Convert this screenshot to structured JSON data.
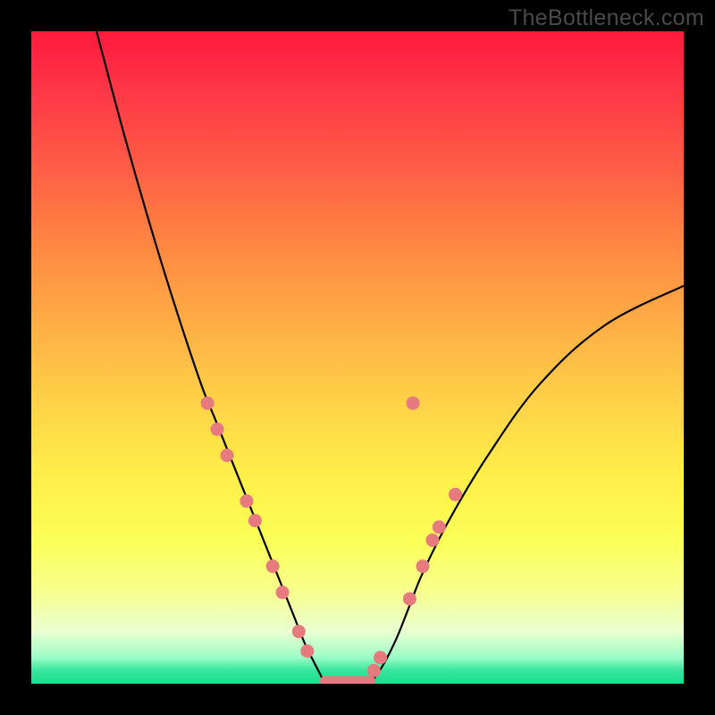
{
  "watermark": "TheBottleneck.com",
  "colors": {
    "dot": "#e77a7f",
    "curve": "#000000",
    "background_black": "#000000"
  },
  "chart_data": {
    "type": "line",
    "title": "",
    "xlabel": "",
    "ylabel": "",
    "xlim": [
      0,
      100
    ],
    "ylim": [
      0,
      100
    ],
    "series": [
      {
        "name": "left-curve",
        "x": [
          10,
          14,
          18,
          22,
          26,
          28,
          30,
          32,
          34,
          36,
          38,
          40,
          42,
          44,
          45
        ],
        "y": [
          100,
          85,
          71,
          58,
          46,
          41,
          36,
          31,
          26,
          21,
          16,
          11,
          6,
          2,
          0
        ]
      },
      {
        "name": "right-curve",
        "x": [
          52,
          54,
          56,
          58,
          60,
          64,
          70,
          78,
          88,
          100
        ],
        "y": [
          0,
          3,
          7,
          12,
          17,
          25,
          35,
          46,
          55,
          61
        ]
      },
      {
        "name": "bottom-flat",
        "x": [
          45,
          52
        ],
        "y": [
          0,
          0
        ]
      }
    ],
    "dots_left": [
      {
        "x": 27,
        "y": 43
      },
      {
        "x": 28.5,
        "y": 39
      },
      {
        "x": 30,
        "y": 35
      },
      {
        "x": 33,
        "y": 28
      },
      {
        "x": 34.3,
        "y": 25
      },
      {
        "x": 37,
        "y": 18
      },
      {
        "x": 38.5,
        "y": 14
      },
      {
        "x": 41,
        "y": 8
      },
      {
        "x": 42.3,
        "y": 5
      }
    ],
    "dots_right": [
      {
        "x": 52.5,
        "y": 2
      },
      {
        "x": 53.5,
        "y": 4
      },
      {
        "x": 58,
        "y": 13
      },
      {
        "x": 60,
        "y": 18
      },
      {
        "x": 61.5,
        "y": 22
      },
      {
        "x": 62.5,
        "y": 24
      },
      {
        "x": 65,
        "y": 29
      },
      {
        "x": 58.5,
        "y": 43
      }
    ],
    "gradient_stops": [
      {
        "pos": 0,
        "color": "#ff1a3c"
      },
      {
        "pos": 50,
        "color": "#ffd547"
      },
      {
        "pos": 100,
        "color": "#1ade8f"
      }
    ]
  }
}
